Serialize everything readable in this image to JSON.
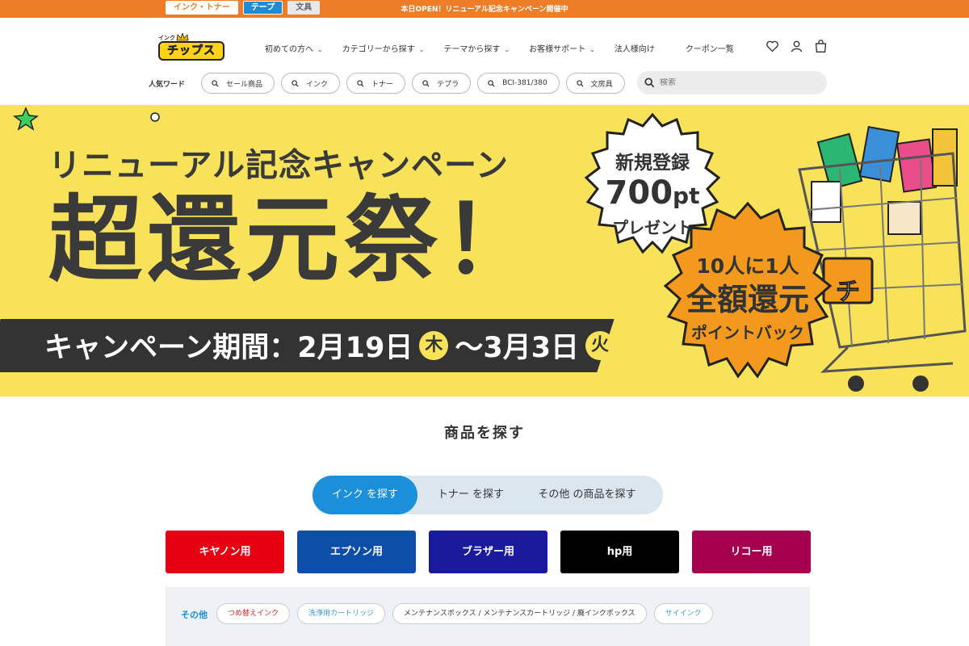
{
  "topbar": {
    "tabs": [
      "インク・トナー",
      "テープ",
      "文具"
    ],
    "notice": "本日OPEN！リニューアル記念キャンペーン開催中"
  },
  "header": {
    "logo_small": "インク",
    "logo_main": "チップス",
    "nav": [
      "初めての方へ",
      "カテゴリーから探す",
      "テーマから探す",
      "お客様サポート",
      "法人様向け",
      "クーポン一覧"
    ],
    "popular_label": "人気ワード",
    "popular_words": [
      "セール商品",
      "インク",
      "トナー",
      "テプラ",
      "BCI-381/380",
      "文房具"
    ],
    "search_placeholder": "検索"
  },
  "banner": {
    "subtitle": "リニューアル記念キャンペーン",
    "title": "超還元祭！",
    "period_label": "キャンペーン期間：",
    "start": "2月19日",
    "start_day": "木",
    "tilde": "～",
    "end": "3月3日",
    "end_day": "火",
    "seal1_l1": "新規登録",
    "seal1_l2": "700",
    "seal1_unit": "pt",
    "seal1_l3": "プレゼント",
    "seal2_l1": "10人に1人",
    "seal2_l2": "全額還元",
    "seal2_l3": "ポイントバック",
    "cart_sign": "チ"
  },
  "products": {
    "title": "商品を探す",
    "tabs": [
      "インク を探す",
      "トナー を探す",
      "その他 の商品を探す"
    ],
    "brands": [
      {
        "label": "キヤノン用",
        "color": "#e60012"
      },
      {
        "label": "エプソン用",
        "color": "#0d4ea8"
      },
      {
        "label": "ブラザー用",
        "color": "#1a1a9c"
      },
      {
        "label": "hp用",
        "color": "#000000"
      },
      {
        "label": "リコー用",
        "color": "#a5004f"
      }
    ],
    "other_label": "その他",
    "other_tags": [
      "つめ替えインク",
      "洗浄用カートリッジ",
      "メンテナンスボックス / メンテナンスカートリッジ / 廃インクボックス",
      "サイインク"
    ]
  },
  "colors": {
    "accent": "#ee7d27",
    "blue": "#1b8fd9",
    "banner": "#f8e25a"
  }
}
